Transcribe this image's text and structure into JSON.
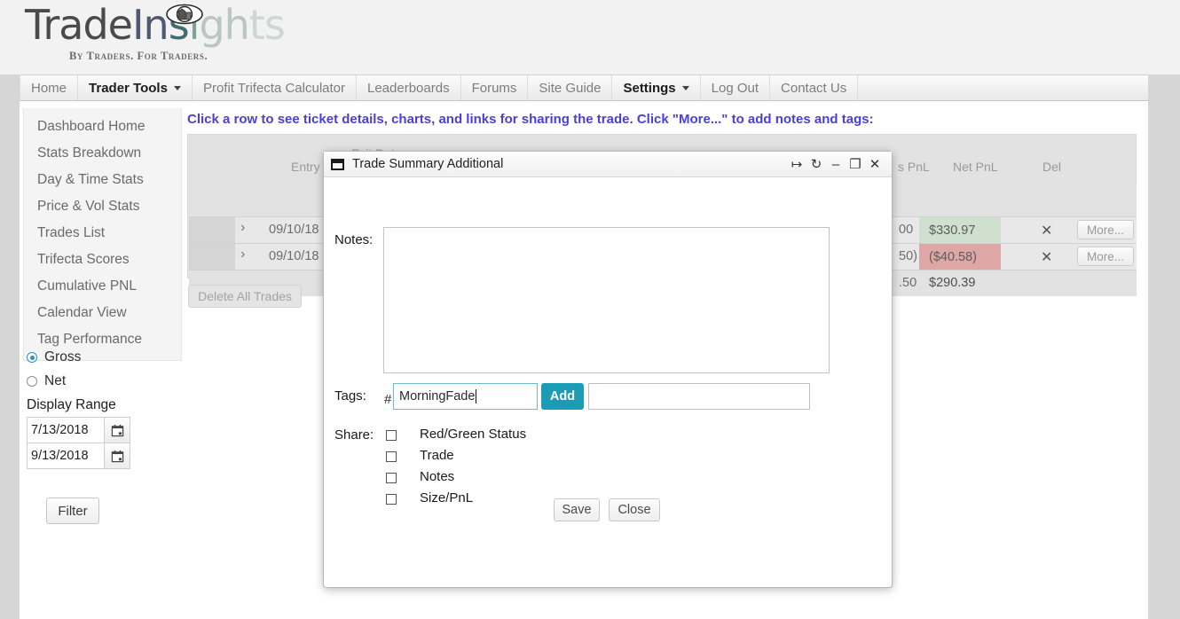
{
  "brand": {
    "name_parts": [
      "Trade",
      "In",
      "s",
      "i",
      "gh",
      "ts"
    ],
    "tagline": "By Traders. For Traders.",
    "eye_icon": "eye-icon"
  },
  "topnav": {
    "items": [
      {
        "label": "Home",
        "active": false,
        "caret": false
      },
      {
        "label": "Trader Tools",
        "active": true,
        "caret": true
      },
      {
        "label": "Profit Trifecta Calculator",
        "active": false,
        "caret": false
      },
      {
        "label": "Leaderboards",
        "active": false,
        "caret": false
      },
      {
        "label": "Forums",
        "active": false,
        "caret": false
      },
      {
        "label": "Site Guide",
        "active": false,
        "caret": false
      },
      {
        "label": "Settings",
        "active": true,
        "caret": true
      },
      {
        "label": "Log Out",
        "active": false,
        "caret": false
      },
      {
        "label": "Contact Us",
        "active": false,
        "caret": false
      }
    ]
  },
  "sidebar": {
    "items": [
      {
        "label": "Dashboard Home"
      },
      {
        "label": "Stats Breakdown"
      },
      {
        "label": "Day & Time Stats"
      },
      {
        "label": "Price & Vol Stats"
      },
      {
        "label": "Trades List"
      },
      {
        "label": "Trifecta Scores"
      },
      {
        "label": "Cumulative PNL"
      },
      {
        "label": "Calendar View"
      },
      {
        "label": "Tag Performance"
      }
    ],
    "pnl_mode": {
      "gross_label": "Gross",
      "net_label": "Net",
      "selected": "Gross"
    },
    "display_range": {
      "title": "Display Range",
      "start_date": "7/13/2018",
      "end_date": "9/13/2018",
      "calendar_icon": "calendar-icon"
    },
    "filter_label": "Filter"
  },
  "trades": {
    "instruction": "Click a row to see ticket details, charts, and links for sharing the trade. Click \"More...\" to add notes and tags:",
    "columns": [
      {
        "label": "Entry Date"
      },
      {
        "label": "Exit Date"
      },
      {
        "label": "s PnL"
      },
      {
        "label": "Net PnL"
      },
      {
        "label": "Del"
      }
    ],
    "rows": [
      {
        "entry_date": "09/10/18",
        "net_pnl": "$330.97",
        "gross_pnl_frag": "00",
        "pnl_state": "positive",
        "del_icon": "close-icon",
        "more_label": "More..."
      },
      {
        "entry_date": "09/10/18",
        "net_pnl": "($40.58)",
        "gross_pnl_frag": "50)",
        "pnl_state": "negative",
        "del_icon": "close-icon",
        "more_label": "More..."
      }
    ],
    "total_row": {
      "gross_pnl_frag": ".50",
      "net_pnl": "$290.39"
    },
    "delete_all_label": "Delete All Trades"
  },
  "modal": {
    "title": "Trade Summary Additional",
    "window_icon": "window-icon",
    "title_buttons": [
      {
        "icon": "pin-icon",
        "glyph": "↦"
      },
      {
        "icon": "refresh-icon",
        "glyph": "↻"
      },
      {
        "icon": "minimize-icon",
        "glyph": "–"
      },
      {
        "icon": "maximize-icon",
        "glyph": "❐"
      },
      {
        "icon": "close-icon",
        "glyph": "✕"
      }
    ],
    "notes": {
      "label": "Notes:",
      "value": "",
      "placeholder": ""
    },
    "tags": {
      "label": "Tags:",
      "hash_prefix": "#",
      "input_value": "MorningFade",
      "placeholder": "",
      "add_label": "Add",
      "add_color": "#1a9cb7",
      "tag_list_value": ""
    },
    "share": {
      "label": "Share:",
      "options": [
        {
          "label": "Red/Green Status",
          "checked": false
        },
        {
          "label": "Trade",
          "checked": false
        },
        {
          "label": "Notes",
          "checked": false
        },
        {
          "label": "Size/PnL",
          "checked": false
        }
      ]
    },
    "footer": {
      "save_label": "Save",
      "close_label": "Close"
    }
  }
}
